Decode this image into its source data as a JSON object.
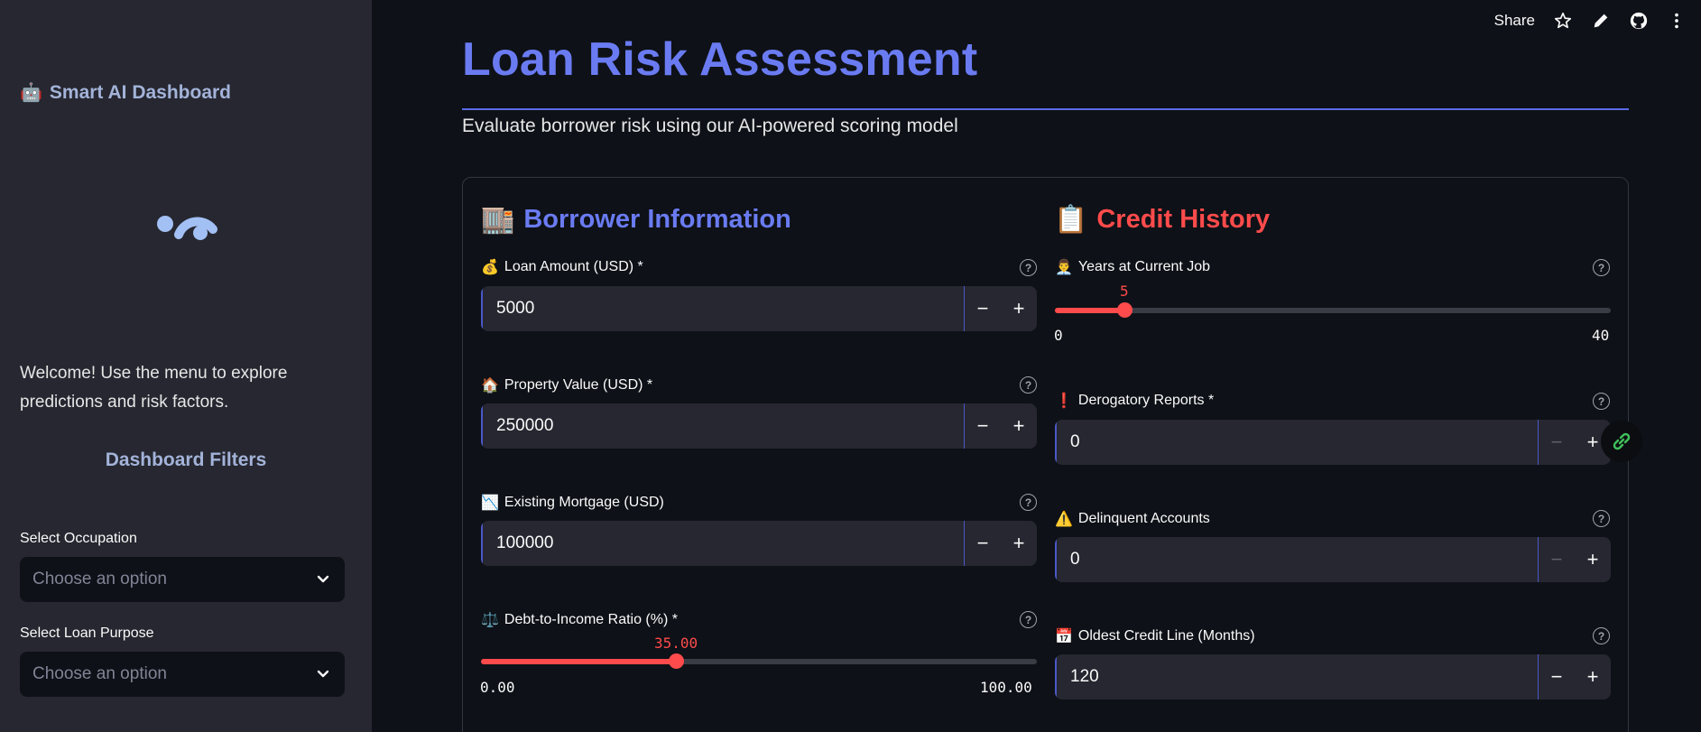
{
  "sidebar": {
    "brand": "Smart AI Dashboard",
    "brand_icon": "robot-face-icon",
    "welcome": "Welcome! Use the menu to explore predictions and risk factors.",
    "filters_title": "Dashboard Filters",
    "occupation": {
      "label": "Select Occupation",
      "placeholder": "Choose an option"
    },
    "loan_purpose": {
      "label": "Select Loan Purpose",
      "placeholder": "Choose an option"
    }
  },
  "toolbar": {
    "share": "Share"
  },
  "main": {
    "title": "Loan Risk Assessment",
    "subtitle": "Evaluate borrower risk using our AI-powered scoring model"
  },
  "borrower": {
    "title": "Borrower Information",
    "emoji": "🏬",
    "loan_amount": {
      "emoji": "💰",
      "label": "Loan Amount (USD) *",
      "value": "5000"
    },
    "property_value": {
      "emoji": "🏠",
      "label": "Property Value (USD) *",
      "value": "250000"
    },
    "mortgage": {
      "emoji": "📉",
      "label": "Existing Mortgage (USD)",
      "value": "100000"
    },
    "dti": {
      "emoji": "⚖️",
      "label": "Debt-to-Income Ratio (%) *",
      "value": "35.00",
      "min": "0.00",
      "max": "100.00",
      "fraction": 0.35
    }
  },
  "credit": {
    "title": "Credit History",
    "emoji": "📋",
    "years_job": {
      "emoji": "👨‍💼",
      "label": "Years at Current Job",
      "value": "5",
      "min": "0",
      "max": "40",
      "fraction": 0.125
    },
    "derog": {
      "emoji": "❗",
      "label": "Derogatory Reports *",
      "value": "0"
    },
    "delinquent": {
      "emoji": "⚠️",
      "label": "Delinquent Accounts",
      "value": "0"
    },
    "oldest_line": {
      "emoji": "📅",
      "label": "Oldest Credit Line (Months)",
      "value": "120"
    }
  },
  "colors": {
    "accent_blue": "#6a7bf2",
    "accent_red": "#ff4b4b",
    "sidebar_bg": "#262730",
    "app_bg": "#0e1117"
  }
}
